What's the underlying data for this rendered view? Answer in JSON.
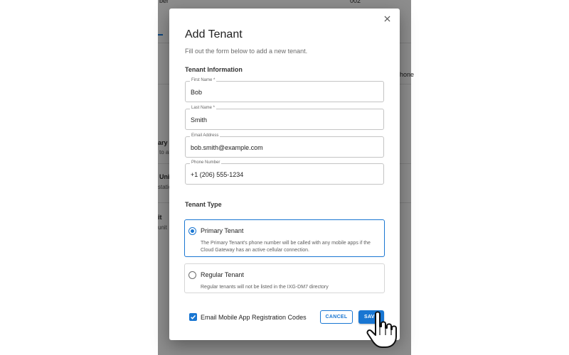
{
  "background": {
    "fragments": [
      {
        "id": "bg-number",
        "text": "002"
      },
      {
        "id": "bg-header-left",
        "text": "ber"
      },
      {
        "id": "bg-phone",
        "text": "hone"
      },
      {
        "id": "bg-row1-title",
        "text": "ary T"
      },
      {
        "id": "bg-row1-sub",
        "text": "to al"
      },
      {
        "id": "bg-row2-title",
        "text": "Uni"
      },
      {
        "id": "bg-row2-sub",
        "text": "statio"
      },
      {
        "id": "bg-row3-title",
        "text": "it"
      },
      {
        "id": "bg-row3-sub",
        "text": "unit"
      }
    ]
  },
  "modal": {
    "title": "Add Tenant",
    "subtitle": "Fill out the form below to add a new tenant.",
    "close_icon": "close-icon",
    "section_info": "Tenant Information",
    "fields": {
      "first_name": {
        "label": "First Name *",
        "value": "Bob"
      },
      "last_name": {
        "label": "Last Name *",
        "value": "Smith"
      },
      "email": {
        "label": "Email Address",
        "value": "bob.smith@example.com"
      },
      "phone": {
        "label": "Phone Number",
        "value": "+1 (206) 555-1234"
      }
    },
    "section_type": "Tenant Type",
    "tenant_types": [
      {
        "title": "Primary Tenant",
        "description": "The Primary Tenant's phone number will be called with any mobile apps if the Cloud Gateway has an active cellular connection.",
        "selected": true
      },
      {
        "title": "Regular Tenant",
        "description": "Regular tenants will not be listed in the IXG-DM7 directory",
        "selected": false
      }
    ],
    "checkbox": {
      "label": "Email Mobile App Registration Codes",
      "checked": true
    },
    "buttons": {
      "cancel": "CANCEL",
      "save": "SAVE"
    }
  },
  "colors": {
    "accent": "#1976d2",
    "overlay": "rgba(0,0,0,0.42)"
  }
}
